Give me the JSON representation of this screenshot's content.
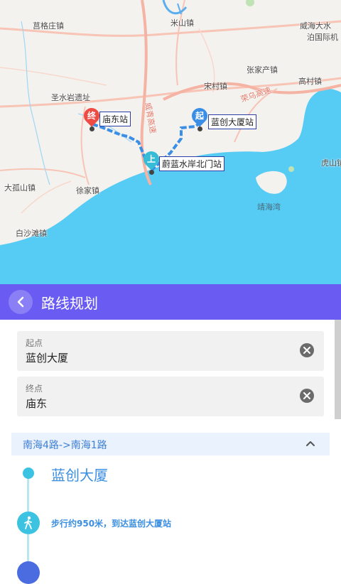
{
  "map": {
    "places": [
      "莒格庄镇",
      "米山镇",
      "威海大水",
      "泊国际机",
      "张家产镇",
      "宋村镇",
      "高村镇",
      "荣乌高速",
      "圣水岩遗址",
      "威青高速",
      "大孤山镇",
      "徐家镇",
      "虎山镇",
      "白沙滩镇",
      "靖海湾",
      "镇"
    ],
    "stops": {
      "end": {
        "glyph": "终",
        "label": "庙东站"
      },
      "start": {
        "glyph": "起",
        "label": "蓝创大厦站"
      },
      "board": {
        "glyph": "上",
        "label": "蔚蓝水岸北门站"
      }
    },
    "colors": {
      "land": "#f4f2ee",
      "sea": "#56cbf4",
      "route": "#3a8ee6",
      "end_marker": "#ee4b45",
      "start_marker": "#3a8ee6",
      "board_marker": "#36bcd6"
    }
  },
  "header": {
    "title": "路线规划",
    "back_icon": "chevron-left-icon",
    "bg": "#6a5cf2"
  },
  "origin": {
    "label": "起点",
    "value": "蓝创大厦"
  },
  "destination": {
    "label": "终点",
    "value": "庙东"
  },
  "route": {
    "summary": "南海4路->南海1路",
    "steps": [
      {
        "type": "start",
        "name": "蓝创大厦"
      },
      {
        "type": "walk",
        "text": "步行约950米，到达蓝创大厦站"
      }
    ]
  }
}
